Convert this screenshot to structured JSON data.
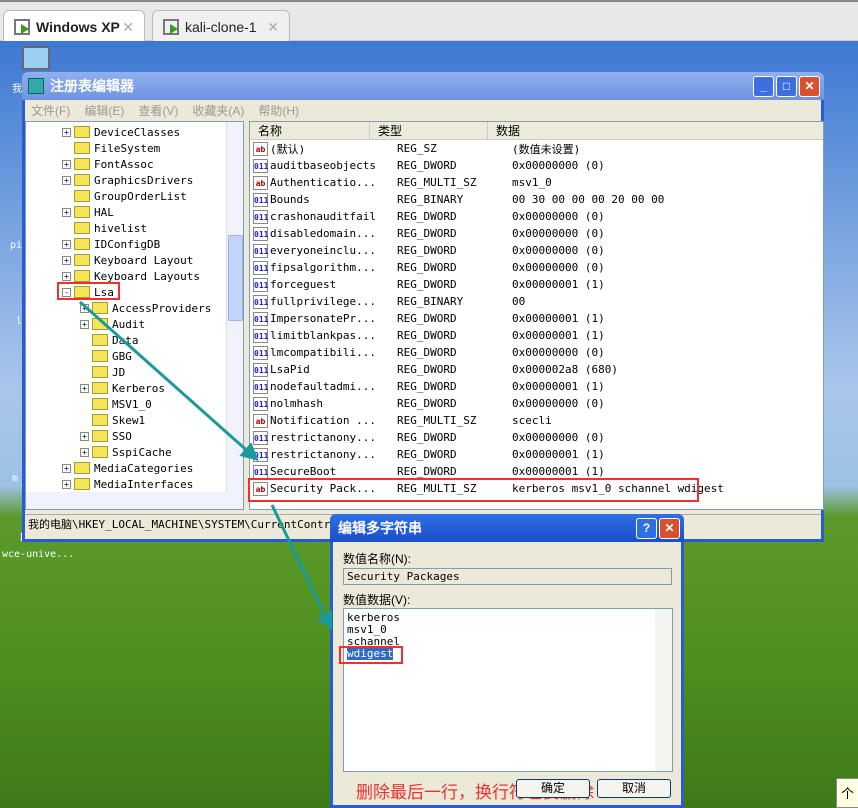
{
  "tabs": [
    {
      "label": "Windows XP",
      "active": true
    },
    {
      "label": "kali-clone-1",
      "active": false
    }
  ],
  "desktop": {
    "icon_label": "wce-unive...",
    "left_labels": [
      "我",
      "pi",
      "l",
      "m"
    ],
    "right_label": "个"
  },
  "regedit": {
    "title": "注册表编辑器",
    "menu": [
      "文件(F)",
      "编辑(E)",
      "查看(V)",
      "收藏夹(A)",
      "帮助(H)"
    ],
    "tree": [
      {
        "label": "DeviceClasses",
        "expand": "+",
        "level": 1
      },
      {
        "label": "FileSystem",
        "expand": "",
        "level": 1
      },
      {
        "label": "FontAssoc",
        "expand": "+",
        "level": 1
      },
      {
        "label": "GraphicsDrivers",
        "expand": "+",
        "level": 1
      },
      {
        "label": "GroupOrderList",
        "expand": "",
        "level": 1
      },
      {
        "label": "HAL",
        "expand": "+",
        "level": 1
      },
      {
        "label": "hivelist",
        "expand": "",
        "level": 1
      },
      {
        "label": "IDConfigDB",
        "expand": "+",
        "level": 1
      },
      {
        "label": "Keyboard Layout",
        "expand": "+",
        "level": 1
      },
      {
        "label": "Keyboard Layouts",
        "expand": "+",
        "level": 1
      },
      {
        "label": "Lsa",
        "expand": "-",
        "level": 1,
        "selected": true
      },
      {
        "label": "AccessProviders",
        "expand": "+",
        "level": 2
      },
      {
        "label": "Audit",
        "expand": "+",
        "level": 2
      },
      {
        "label": "Data",
        "expand": "",
        "level": 2
      },
      {
        "label": "GBG",
        "expand": "",
        "level": 2
      },
      {
        "label": "JD",
        "expand": "",
        "level": 2
      },
      {
        "label": "Kerberos",
        "expand": "+",
        "level": 2
      },
      {
        "label": "MSV1_0",
        "expand": "",
        "level": 2
      },
      {
        "label": "Skew1",
        "expand": "",
        "level": 2
      },
      {
        "label": "SSO",
        "expand": "+",
        "level": 2
      },
      {
        "label": "SspiCache",
        "expand": "+",
        "level": 2
      },
      {
        "label": "MediaCategories",
        "expand": "+",
        "level": 1
      },
      {
        "label": "MediaInterfaces",
        "expand": "+",
        "level": 1
      }
    ],
    "columns": [
      "名称",
      "类型",
      "数据"
    ],
    "rows": [
      {
        "name": "(默认)",
        "type": "REG_SZ",
        "data": "(数值未设置)",
        "icon": "string"
      },
      {
        "name": "auditbaseobjects",
        "type": "REG_DWORD",
        "data": "0x00000000 (0)",
        "icon": "binary"
      },
      {
        "name": "Authenticatio...",
        "type": "REG_MULTI_SZ",
        "data": "msv1_0",
        "icon": "string"
      },
      {
        "name": "Bounds",
        "type": "REG_BINARY",
        "data": "00 30 00 00 00 20 00 00",
        "icon": "binary"
      },
      {
        "name": "crashonauditfail",
        "type": "REG_DWORD",
        "data": "0x00000000 (0)",
        "icon": "binary"
      },
      {
        "name": "disabledomain...",
        "type": "REG_DWORD",
        "data": "0x00000000 (0)",
        "icon": "binary"
      },
      {
        "name": "everyoneinclu...",
        "type": "REG_DWORD",
        "data": "0x00000000 (0)",
        "icon": "binary"
      },
      {
        "name": "fipsalgorithm...",
        "type": "REG_DWORD",
        "data": "0x00000000 (0)",
        "icon": "binary"
      },
      {
        "name": "forceguest",
        "type": "REG_DWORD",
        "data": "0x00000001 (1)",
        "icon": "binary"
      },
      {
        "name": "fullprivilege...",
        "type": "REG_BINARY",
        "data": "00",
        "icon": "binary"
      },
      {
        "name": "ImpersonatePr...",
        "type": "REG_DWORD",
        "data": "0x00000001 (1)",
        "icon": "binary"
      },
      {
        "name": "limitblankpas...",
        "type": "REG_DWORD",
        "data": "0x00000001 (1)",
        "icon": "binary"
      },
      {
        "name": "lmcompatibili...",
        "type": "REG_DWORD",
        "data": "0x00000000 (0)",
        "icon": "binary"
      },
      {
        "name": "LsaPid",
        "type": "REG_DWORD",
        "data": "0x000002a8 (680)",
        "icon": "binary"
      },
      {
        "name": "nodefaultadmi...",
        "type": "REG_DWORD",
        "data": "0x00000001 (1)",
        "icon": "binary"
      },
      {
        "name": "nolmhash",
        "type": "REG_DWORD",
        "data": "0x00000000 (0)",
        "icon": "binary"
      },
      {
        "name": "Notification ...",
        "type": "REG_MULTI_SZ",
        "data": "scecli",
        "icon": "string"
      },
      {
        "name": "restrictanony...",
        "type": "REG_DWORD",
        "data": "0x00000000 (0)",
        "icon": "binary"
      },
      {
        "name": "restrictanony...",
        "type": "REG_DWORD",
        "data": "0x00000001 (1)",
        "icon": "binary"
      },
      {
        "name": "SecureBoot",
        "type": "REG_DWORD",
        "data": "0x00000001 (1)",
        "icon": "binary"
      },
      {
        "name": "Security Pack...",
        "type": "REG_MULTI_SZ",
        "data": "kerberos msv1_0 schannel wdigest",
        "icon": "string",
        "highlighted": true
      }
    ],
    "status_path": "我的电脑\\HKEY_LOCAL_MACHINE\\SYSTEM\\CurrentControlSe"
  },
  "dialog": {
    "title": "编辑多字符串",
    "name_label": "数值名称(N):",
    "name_value": "Security Packages",
    "data_label": "数值数据(V):",
    "data_lines": [
      "kerberos",
      "msv1_0",
      "schannel",
      "wdigest"
    ],
    "selected_line": "wdigest",
    "annotation": "删除最后一行，换行符也要删除",
    "ok_label": "确定",
    "cancel_label": "取消"
  },
  "colors": {
    "annotation": "#f03030",
    "arrow": "#1a9a9a",
    "title_bar": "#2a5bd7"
  }
}
